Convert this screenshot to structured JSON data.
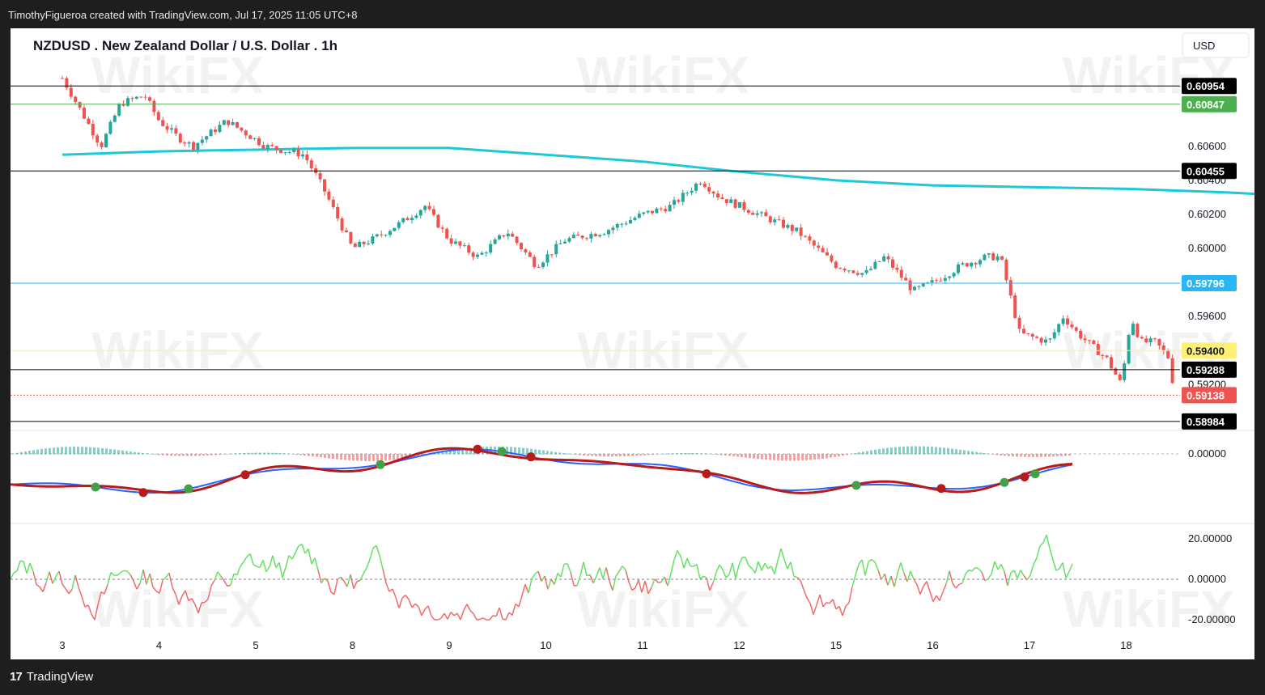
{
  "header": {
    "credit": "TimothyFigueroa created with TradingView.com, Jul 17, 2025 11:05 UTC+8"
  },
  "footer": {
    "logo_mark": "17",
    "logo_text": "TradingView"
  },
  "watermark": {
    "text": "WikiFX"
  },
  "colors": {
    "up": "#26a69a",
    "down": "#ef5350",
    "ma": "#1ec8d8",
    "macd": "#2962ff",
    "signal_bull": "#43a047",
    "signal_bear": "#b71c1c",
    "osc_up": "#66e066",
    "osc_down": "#f06a6a"
  },
  "chart_data": {
    "type": "candlestick",
    "title": "NZDUSD . New Zealand Dollar / U.S. Dollar . 1h",
    "currency": "USD",
    "x_tick_labels": [
      "3",
      "4",
      "5",
      "8",
      "9",
      "10",
      "11",
      "12",
      "15",
      "16",
      "17",
      "18"
    ],
    "price_axis": {
      "range": [
        0.5895,
        0.6115
      ],
      "tick_labels": [
        "0.60600",
        "0.60400",
        "0.60200",
        "0.60000",
        "0.59600",
        "0.59200"
      ]
    },
    "level_lines": [
      {
        "value": 0.60954,
        "label": "0.60954",
        "color": "#000000",
        "style": "solid"
      },
      {
        "value": 0.60847,
        "label": "0.60847",
        "color": "#4caf50",
        "style": "solid"
      },
      {
        "value": 0.60455,
        "label": "0.60455",
        "color": "#000000",
        "style": "solid"
      },
      {
        "value": 0.59796,
        "label": "0.59796",
        "color": "#29b6f6",
        "style": "solid"
      },
      {
        "value": 0.594,
        "label": "0.59400",
        "color": "#fff176",
        "style": "solid"
      },
      {
        "value": 0.59288,
        "label": "0.59288",
        "color": "#000000",
        "style": "solid"
      },
      {
        "value": 0.59138,
        "label": "0.59138",
        "color": "#ef5350",
        "style": "dotted"
      },
      {
        "value": 0.58984,
        "label": "0.58984",
        "color": "#000000",
        "style": "solid"
      }
    ],
    "moving_average": {
      "points": [
        [
          0,
          0.6055
        ],
        [
          1,
          0.6057
        ],
        [
          2,
          0.6058
        ],
        [
          3,
          0.6059
        ],
        [
          4,
          0.6059
        ],
        [
          5,
          0.6055
        ],
        [
          6,
          0.6051
        ],
        [
          7,
          0.6045
        ],
        [
          8,
          0.604
        ],
        [
          9,
          0.6037
        ],
        [
          10,
          0.6036
        ],
        [
          11,
          0.6035
        ],
        [
          12,
          0.6033
        ],
        [
          13,
          0.603
        ],
        [
          14,
          0.6025
        ],
        [
          14.5,
          0.6013
        ]
      ]
    },
    "price_path": [
      [
        0,
        0.61
      ],
      [
        0.2,
        0.608
      ],
      [
        0.4,
        0.606
      ],
      [
        0.6,
        0.6085
      ],
      [
        0.85,
        0.609
      ],
      [
        1.0,
        0.6075
      ],
      [
        1.2,
        0.6065
      ],
      [
        1.35,
        0.606
      ],
      [
        1.7,
        0.6075
      ],
      [
        2.1,
        0.606
      ],
      [
        2.5,
        0.6055
      ],
      [
        2.7,
        0.6035
      ],
      [
        3.0,
        0.6
      ],
      [
        3.2,
        0.6005
      ],
      [
        3.5,
        0.6015
      ],
      [
        3.75,
        0.6025
      ],
      [
        4.0,
        0.6005
      ],
      [
        4.3,
        0.5995
      ],
      [
        4.6,
        0.601
      ],
      [
        4.9,
        0.599
      ],
      [
        5.2,
        0.6005
      ],
      [
        5.6,
        0.601
      ],
      [
        6.0,
        0.602
      ],
      [
        6.3,
        0.6025
      ],
      [
        6.6,
        0.604
      ],
      [
        6.8,
        0.603
      ],
      [
        7.2,
        0.602
      ],
      [
        7.6,
        0.601
      ],
      [
        8.0,
        0.599
      ],
      [
        8.3,
        0.5985
      ],
      [
        8.5,
        0.5995
      ],
      [
        8.8,
        0.5975
      ],
      [
        9.0,
        0.598
      ],
      [
        9.3,
        0.599
      ],
      [
        9.55,
        0.5995
      ],
      [
        9.7,
        0.5995
      ],
      [
        9.9,
        0.595
      ],
      [
        10.2,
        0.5945
      ],
      [
        10.35,
        0.596
      ],
      [
        10.5,
        0.595
      ],
      [
        10.8,
        0.5935
      ],
      [
        10.95,
        0.592
      ],
      [
        11.05,
        0.596
      ],
      [
        11.15,
        0.5945
      ],
      [
        11.3,
        0.5945
      ],
      [
        11.45,
        0.5935
      ],
      [
        11.5,
        0.5913
      ]
    ],
    "panels": [
      {
        "name": "macd",
        "zero_label": "0.00000"
      },
      {
        "name": "oscillator",
        "tick_labels": [
          "20.00000",
          "0.00000",
          "-20.00000"
        ]
      }
    ]
  }
}
